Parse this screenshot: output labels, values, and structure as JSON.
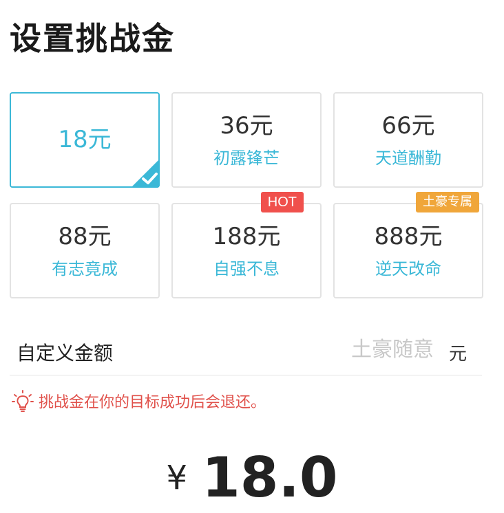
{
  "page": {
    "title": "设置挑战金"
  },
  "options": [
    {
      "amount": "18元",
      "motto": "",
      "selected": true,
      "tag": ""
    },
    {
      "amount": "36元",
      "motto": "初露锋芒",
      "selected": false,
      "tag": ""
    },
    {
      "amount": "66元",
      "motto": "天道酬勤",
      "selected": false,
      "tag": ""
    },
    {
      "amount": "88元",
      "motto": "有志竟成",
      "selected": false,
      "tag": ""
    },
    {
      "amount": "188元",
      "motto": "自强不息",
      "selected": false,
      "tag": "HOT"
    },
    {
      "amount": "888元",
      "motto": "逆天改命",
      "selected": false,
      "tag": "土豪专属"
    }
  ],
  "custom": {
    "label": "自定义金额",
    "placeholder": "土豪随意",
    "unit": "元"
  },
  "tip": {
    "text": "挑战金在你的目标成功后会退还。"
  },
  "total": {
    "currency": "¥",
    "value": "18.0"
  },
  "colors": {
    "accent": "#3bb8d7",
    "hot": "#f0504c",
    "rich": "#f0a63a",
    "tip": "#e0504a"
  },
  "icons": {
    "selected": "check-icon",
    "tip": "lightbulb-icon"
  }
}
